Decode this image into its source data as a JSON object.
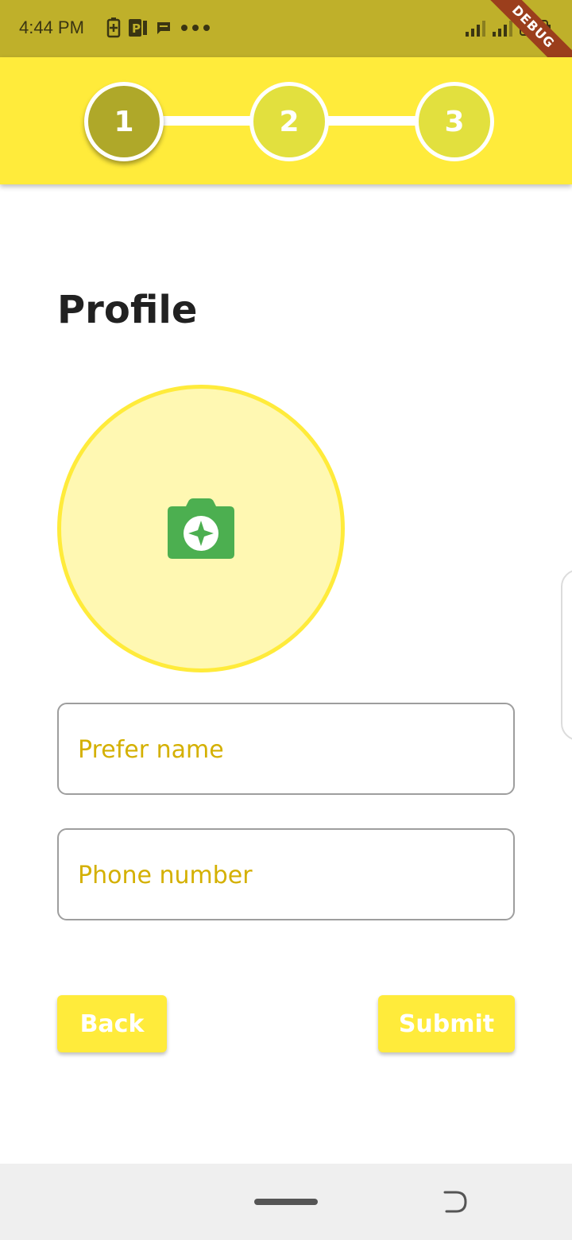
{
  "status_bar": {
    "time": "4:44 PM",
    "left_icons": [
      "battery-saver-icon",
      "parking-app-icon",
      "message-icon",
      "more-dots-icon"
    ],
    "right_icons": [
      "signal-icon",
      "signal-icon",
      "battery-icon"
    ],
    "debug_label": "DEBUG"
  },
  "stepper": {
    "steps": [
      {
        "label": "1",
        "state": "active"
      },
      {
        "label": "2",
        "state": "inactive"
      },
      {
        "label": "3",
        "state": "inactive"
      }
    ]
  },
  "page": {
    "title": "Profile"
  },
  "avatar": {
    "icon": "add-photo-camera-icon"
  },
  "form": {
    "name_placeholder": "Prefer name",
    "name_value": "",
    "phone_placeholder": "Phone number",
    "phone_value": ""
  },
  "actions": {
    "back_label": "Back",
    "submit_label": "Submit"
  },
  "colors": {
    "status_bar": "#bfb02a",
    "accent": "#ffeb3b",
    "step_active": "#afa829",
    "step_inactive": "#e2e03e",
    "camera_icon": "#4caf50",
    "placeholder_text": "#d4b000"
  }
}
